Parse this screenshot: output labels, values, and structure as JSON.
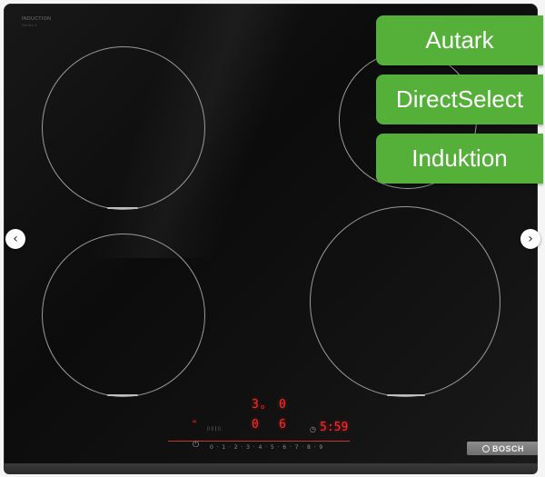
{
  "product": {
    "brand_top_label": "INDUCTION",
    "brand_top_sub": "Series 4",
    "brand_logo_text": "BOSCH"
  },
  "badges": [
    "Autark",
    "DirectSelect",
    "Induktion"
  ],
  "display": {
    "top_left_digit": "3",
    "top_left_small": "o",
    "top_right_digit": "0",
    "mid_left_digit": "0",
    "mid_right_digit": "6",
    "timer": "5:59"
  },
  "power_scale": [
    "0",
    "1",
    "2",
    "3",
    "4",
    "5",
    "6",
    "7",
    "8",
    "9"
  ],
  "gallery": {
    "prev_arrow": "‹",
    "next_arrow": "›"
  },
  "colors": {
    "badge_green": "#55b03a",
    "display_red": "#ff2a2a",
    "glass": "#111111"
  },
  "icons": [
    "power-icon",
    "timer-icon",
    "chevron-left-icon",
    "chevron-right-icon",
    "bosch-logo-icon"
  ]
}
